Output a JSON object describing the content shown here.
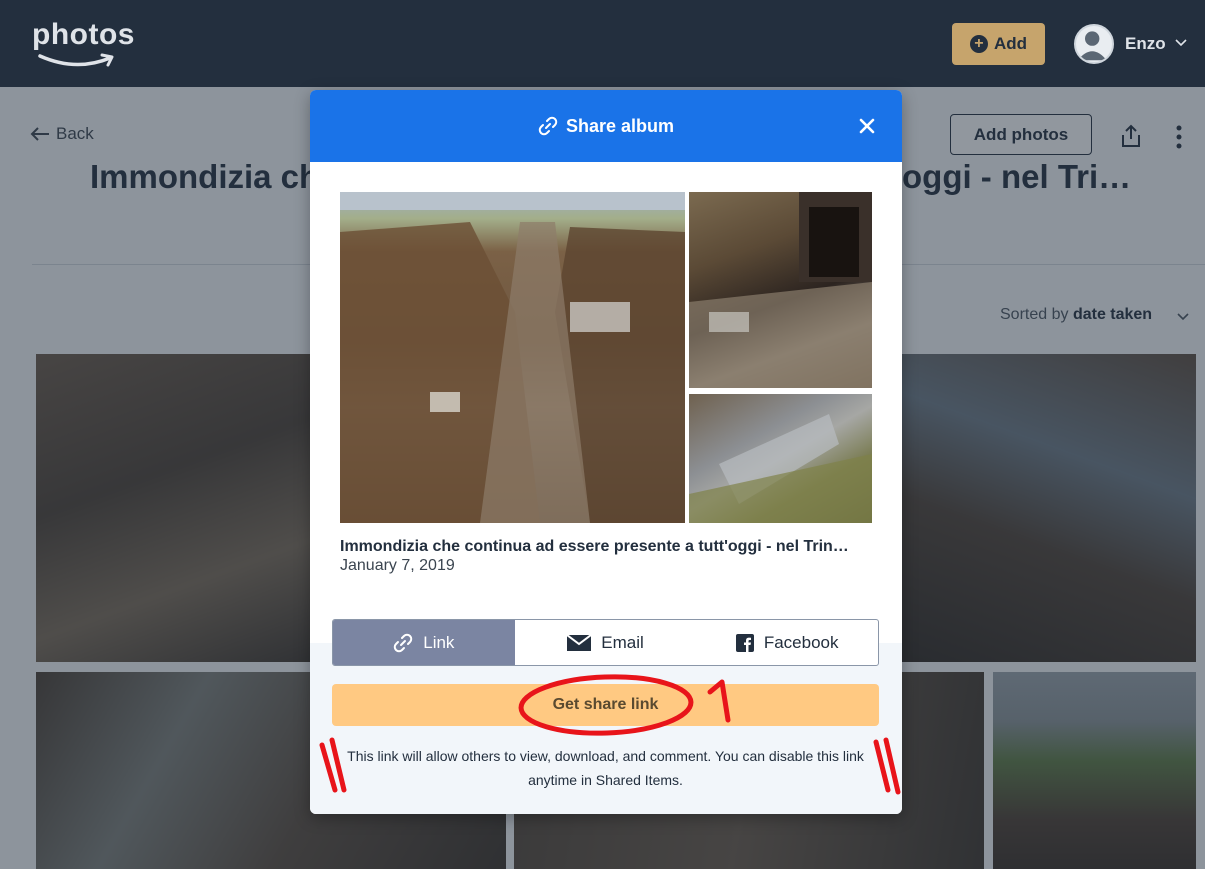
{
  "topbar": {
    "logo": "photos",
    "add_label": "Add",
    "user_name": "Enzo"
  },
  "page": {
    "back_label": "Back",
    "album_title_left": "Immondizia ch",
    "album_title_right": "oggi - nel Tri…",
    "add_photos_label": "Add photos",
    "sort_prefix": "Sorted by",
    "sort_value": "date taken"
  },
  "modal": {
    "title": "Share album",
    "album_title": "Immondizia che continua ad essere presente a tutt'oggi - nel Trin…",
    "album_date": "January 7, 2019",
    "tabs": [
      {
        "label": "Link",
        "icon": "link-icon",
        "active": true
      },
      {
        "label": "Email",
        "icon": "envelope-icon",
        "active": false
      },
      {
        "label": "Facebook",
        "icon": "facebook-icon",
        "active": false
      }
    ],
    "get_link_label": "Get share link",
    "info_text": "This link will allow others to view, download, and comment. You can disable this link anytime in Shared Items."
  },
  "annotations": {
    "step_number": "1"
  },
  "colors": {
    "topbar": "#232f3e",
    "accent_blue": "#1a73e8",
    "add_button": "#c6a46c",
    "get_link_button": "#ffc982",
    "active_tab": "#7b85a2",
    "annotation_red": "#e8141a"
  }
}
